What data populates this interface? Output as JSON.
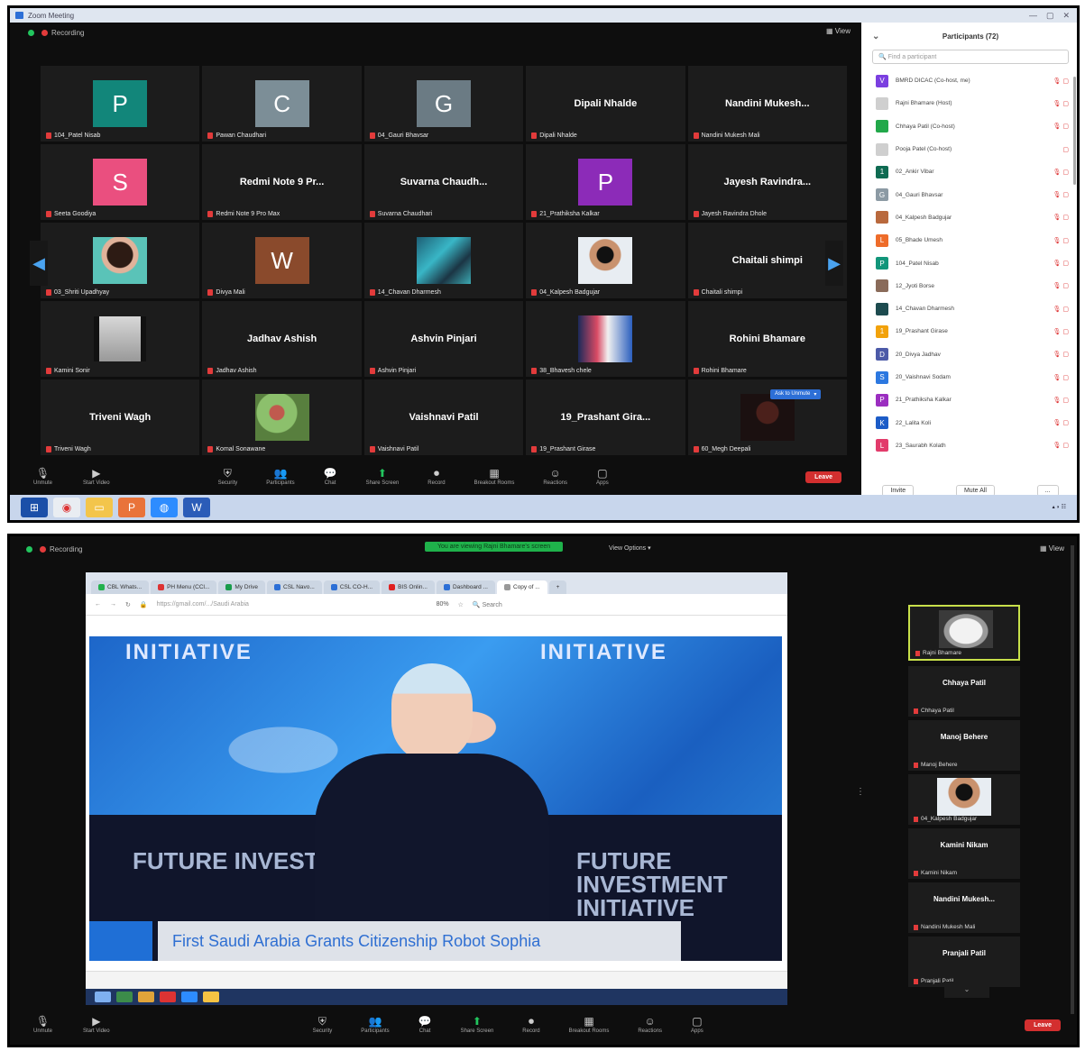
{
  "top": {
    "window_title": "Zoom Meeting",
    "recording": "Recording",
    "view": "View",
    "ask_to_unmute": "Ask to Unmute",
    "tiles": [
      {
        "type": "avatar",
        "letter": "P",
        "color": "#12867a",
        "name": "104_Patel Nisab"
      },
      {
        "type": "avatar",
        "letter": "C",
        "color": "#7c8e97",
        "name": "Pawan Chaudhari"
      },
      {
        "type": "avatar",
        "letter": "G",
        "color": "#6b7b84",
        "name": "04_Gauri Bhavsar"
      },
      {
        "type": "text",
        "big": "Dipali Nhalde",
        "name": "Dipali Nhalde"
      },
      {
        "type": "text",
        "big": "Nandini Mukesh...",
        "name": "Nandini Mukesh Mali"
      },
      {
        "type": "avatar",
        "letter": "S",
        "color": "#ea4f7f",
        "name": "Seeta Goodiya"
      },
      {
        "type": "text",
        "big": "Redmi Note 9 Pr...",
        "name": "Redmi Note 9 Pro Max"
      },
      {
        "type": "text",
        "big": "Suvarna Chaudh...",
        "name": "Suvarna Chaudhari"
      },
      {
        "type": "avatar",
        "letter": "P",
        "color": "#8c2bb8",
        "name": "21_Prathiksha Kalkar"
      },
      {
        "type": "text",
        "big": "Jayesh Ravindra...",
        "name": "Jayesh Ravindra Dhole"
      },
      {
        "type": "photo",
        "img": "ph-woman",
        "name": "03_Shriti Upadhyay"
      },
      {
        "type": "avatar",
        "letter": "W",
        "color": "#8a4a2c",
        "name": "Divya Mali"
      },
      {
        "type": "photo",
        "img": "ph-water",
        "name": "14_Chavan Dharmesh"
      },
      {
        "type": "photo",
        "img": "ph-man",
        "name": "04_Kalpesh Badgujar"
      },
      {
        "type": "text",
        "big": "Chaitali shimpi",
        "name": "Chaitali shimpi"
      },
      {
        "type": "photo",
        "img": "ph-w",
        "name": "Kamini Sonir"
      },
      {
        "type": "text",
        "big": "Jadhav Ashish",
        "name": "Jadhav Ashish"
      },
      {
        "type": "text",
        "big": "Ashvin Pinjari",
        "name": "Ashvin Pinjari"
      },
      {
        "type": "photo",
        "img": "ph-poster",
        "name": "38_Bhavesh chele"
      },
      {
        "type": "text",
        "big": "Rohini Bhamare",
        "name": "Rohini Bhamare"
      },
      {
        "type": "text",
        "big": "Triveni Wagh",
        "name": "Triveni Wagh"
      },
      {
        "type": "photo",
        "img": "ph-green",
        "name": "Komal Sonawane"
      },
      {
        "type": "text",
        "big": "Vaishnavi Patil",
        "name": "Vaishnavi Patil"
      },
      {
        "type": "text",
        "big": "19_Prashant Gira...",
        "name": "19_Prashant Girase"
      },
      {
        "type": "photo",
        "img": "ph-dark",
        "name": "60_Megh Deepali"
      }
    ],
    "toolbar": [
      {
        "icon": "🎙",
        "label": "Unmute"
      },
      {
        "icon": "▶",
        "label": "Start Video"
      },
      {
        "icon": "⛨",
        "label": "Security"
      },
      {
        "icon": "👥",
        "label": "Participants"
      },
      {
        "icon": "💬",
        "label": "Chat"
      },
      {
        "icon": "⬆",
        "label": "Share Screen",
        "green": true
      },
      {
        "icon": "⏺",
        "label": "Record"
      },
      {
        "icon": "▦",
        "label": "Breakout Rooms"
      },
      {
        "icon": "☺",
        "label": "Reactions"
      },
      {
        "icon": "▢",
        "label": "Apps"
      }
    ],
    "end": "Leave",
    "participants": {
      "title": "Participants (72)",
      "search_placeholder": "Find a participant",
      "rows": [
        {
          "letter": "V",
          "color": "#7b3fe0",
          "name": "BMRD DICAC (Co-host, me)",
          "status": "🎙 ▢"
        },
        {
          "letter": "",
          "color": "#cfcfcf",
          "name": "Rajni Bhamare (Host)",
          "status": "🎙 ▢"
        },
        {
          "letter": "",
          "color": "#22a84a",
          "name": "Chhaya Patil (Co-host)",
          "status": "🎙 ▢"
        },
        {
          "letter": "",
          "color": "#cfcfcf",
          "name": "Pooja Patel (Co-host)",
          "status": "▢"
        },
        {
          "letter": "1",
          "color": "#0f6b52",
          "name": "02_Ankir Vibar",
          "status": "🎙 ▢"
        },
        {
          "letter": "G",
          "color": "#8c9aa4",
          "name": "04_Gauri Bhavsar",
          "status": "🎙 ▢"
        },
        {
          "letter": "",
          "color": "#b9693d",
          "name": "04_Kalpesh Badgujar",
          "status": "🎙 ▢"
        },
        {
          "letter": "L",
          "color": "#ee6c2a",
          "name": "05_Bhade Umesh",
          "status": "🎙 ▢"
        },
        {
          "letter": "P",
          "color": "#12967a",
          "name": "104_Patel Nisab",
          "status": "🎙 ▢"
        },
        {
          "letter": "",
          "color": "#8a6b5a",
          "name": "12_Jyoti Borse",
          "status": "🎙 ▢"
        },
        {
          "letter": "",
          "color": "#1d4b4f",
          "name": "14_Chavan Dharmesh",
          "status": "🎙 ▢"
        },
        {
          "letter": "1",
          "color": "#f2a20b",
          "name": "19_Prashant Girase",
          "status": "🎙 ▢"
        },
        {
          "letter": "D",
          "color": "#4c5aa8",
          "name": "20_Divya Jadhav",
          "status": "🎙 ▢"
        },
        {
          "letter": "S",
          "color": "#2c78e0",
          "name": "20_Vaishnavi Sodam",
          "status": "🎙 ▢"
        },
        {
          "letter": "P",
          "color": "#9b2ec0",
          "name": "21_Prathiksha Kalkar",
          "status": "🎙 ▢"
        },
        {
          "letter": "K",
          "color": "#1c5cc7",
          "name": "22_Lalita Koli",
          "status": "🎙 ▢"
        },
        {
          "letter": "L",
          "color": "#e23b6b",
          "name": "23_Saurabh Kolath",
          "status": "🎙 ▢"
        }
      ],
      "invite": "Invite",
      "mute_all": "Mute All",
      "more": "..."
    }
  },
  "bottom": {
    "recording": "Recording",
    "banner": "You are viewing Rajni Bhamare's screen",
    "view_options": "View Options",
    "view": "View",
    "browser_tabs": [
      {
        "label": "CBL Whats...",
        "color": "#22b14c"
      },
      {
        "label": "PH Menu (CCl...",
        "color": "#d33"
      },
      {
        "label": "My Drive",
        "color": "#1a9c4b"
      },
      {
        "label": "CSL Navo...",
        "color": "#2c6fd6"
      },
      {
        "label": "CSL CO-H...",
        "color": "#2c6fd6"
      },
      {
        "label": "BIS Onlin...",
        "color": "#e02020"
      },
      {
        "label": "Dashboard ...",
        "color": "#2c6fd6"
      },
      {
        "label": "Copy of ...",
        "color": "#999",
        "active": true
      }
    ],
    "url": "https://gmail.com/.../Saudi Arabia",
    "zoom": "80%",
    "search": "Search",
    "video_text_left": "INITIATIVE",
    "video_text_right": "INITIATIVE",
    "video_text_bl": "FUTURE INVESTMENT INITIATIVE",
    "video_text_br": "FUTURE INVESTMENT INITIATIVE",
    "caption": "First Saudi Arabia Grants Citizenship Robot Sophia",
    "filmstrip": [
      {
        "type": "photo",
        "name": "Rajni Bhamare"
      },
      {
        "type": "text",
        "big": "Chhaya Patil",
        "name": "Chhaya Patil"
      },
      {
        "type": "text",
        "big": "Manoj Behere",
        "name": "Manoj Behere"
      },
      {
        "type": "photo",
        "name": "04_Kalpesh Badgujar"
      },
      {
        "type": "text",
        "big": "Kamini Nikam",
        "name": "Kamini Nikam"
      },
      {
        "type": "text",
        "big": "Nandini Mukesh...",
        "name": "Nandini Mukesh Mali"
      },
      {
        "type": "text",
        "big": "Pranjali Patil",
        "name": "Pranjali Patil"
      }
    ],
    "end": "Leave"
  }
}
